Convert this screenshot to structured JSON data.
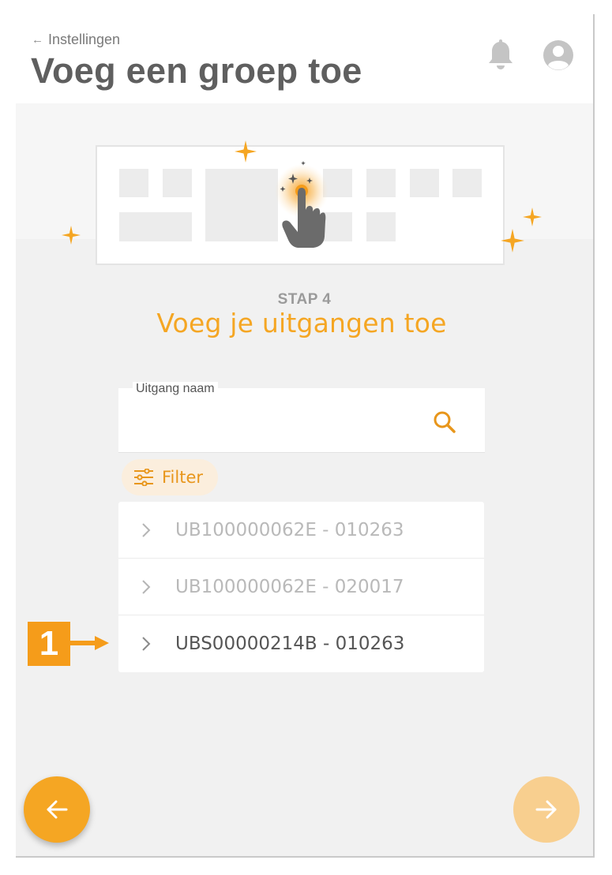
{
  "header": {
    "back_label": "Instellingen",
    "title": "Voeg een groep toe",
    "icons": {
      "notifications": "bell-icon",
      "account": "user-avatar-icon",
      "back": "arrow-left-icon"
    }
  },
  "step": {
    "label": "STAP 4",
    "title": "Voeg je uitgangen toe"
  },
  "search": {
    "label": "Uitgang naam",
    "value": "",
    "placeholder": "",
    "icon": "search-icon"
  },
  "filter": {
    "label": "Filter",
    "icon": "sliders-icon"
  },
  "outputs": [
    {
      "label": "UB100000062E - 010263",
      "state": "muted"
    },
    {
      "label": "UB100000062E - 020017",
      "state": "muted"
    },
    {
      "label": "UBS00000214B - 010263",
      "state": "active"
    }
  ],
  "annotation": {
    "number": "1"
  },
  "colors": {
    "accent": "#f5a623",
    "accent_light": "#f8cf8f",
    "title": "#5f5f5f",
    "background": "#f1f1f1"
  },
  "navigation": {
    "back_icon": "arrow-left-icon",
    "next_icon": "arrow-right-icon"
  }
}
